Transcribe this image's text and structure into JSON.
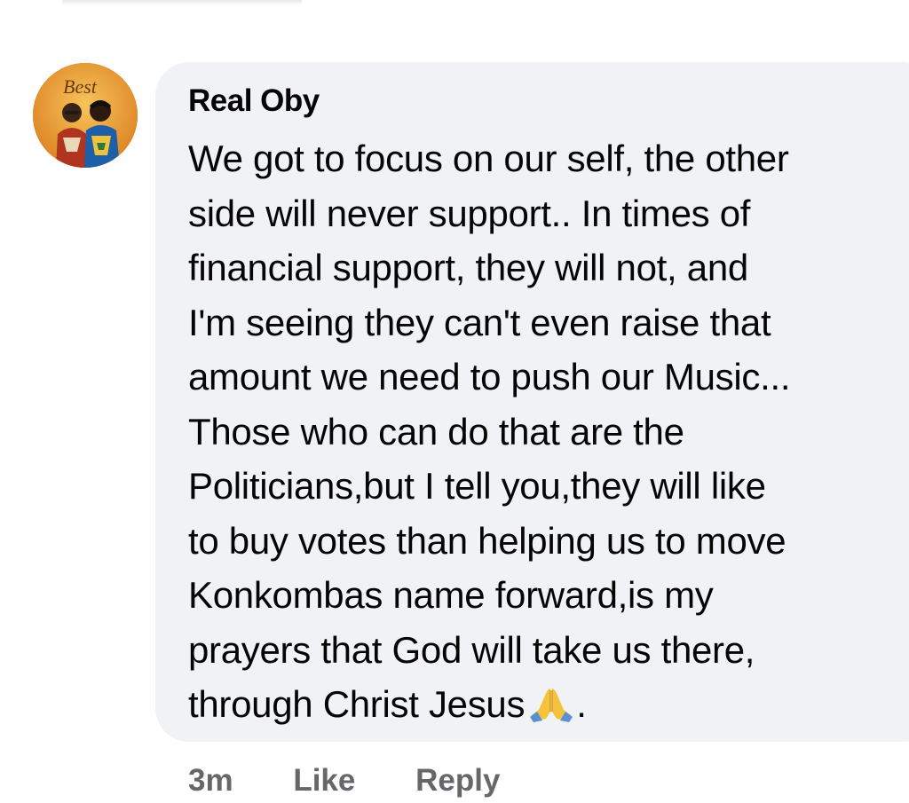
{
  "comment": {
    "author": "Real Oby",
    "avatar_label": "Best",
    "lines": [
      "We got to focus on our self, the other",
      "side will never support.. In times of",
      "financial support, they will not, and",
      "I'm seeing they can't even raise that",
      "amount we need to push our Music...",
      "Those who can do that are the",
      "Politicians,but I tell you,they will like",
      "to buy votes than helping us to move",
      "Konkombas name forward,is my",
      "prayers that God will take us there,",
      "through Christ Jesus"
    ],
    "end_punctuation": ".",
    "emoji": "folded-hands-icon"
  },
  "actions": {
    "time": "3m",
    "like": "Like",
    "reply": "Reply"
  },
  "colors": {
    "bubble": "#f0f2f5",
    "text": "#050505",
    "meta": "#65676b"
  }
}
